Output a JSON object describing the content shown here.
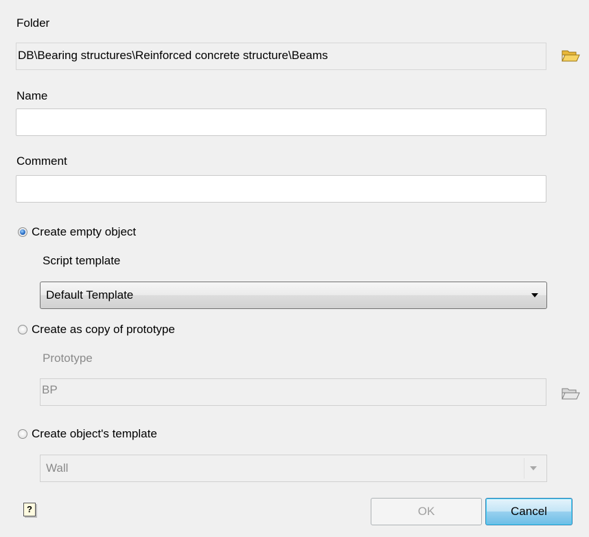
{
  "folder": {
    "label": "Folder",
    "value": "DB\\Bearing structures\\Reinforced concrete structure\\Beams",
    "icon": "folder-open-icon"
  },
  "name": {
    "label": "Name",
    "value": ""
  },
  "comment": {
    "label": "Comment",
    "value": ""
  },
  "options": {
    "empty_object": {
      "label": "Create empty object",
      "checked": true,
      "script_template_label": "Script template",
      "script_template_value": "Default Template"
    },
    "copy_prototype": {
      "label": "Create as copy of prototype",
      "checked": false,
      "prototype_label": "Prototype",
      "prototype_value": "BP"
    },
    "object_template": {
      "label": "Create object's template",
      "checked": false,
      "template_value": "Wall"
    }
  },
  "buttons": {
    "ok": "OK",
    "cancel": "Cancel",
    "help": "?"
  },
  "colors": {
    "background": "#f0f0f0",
    "folder_icon": "#f5c842",
    "default_button": "#98d1ef"
  }
}
